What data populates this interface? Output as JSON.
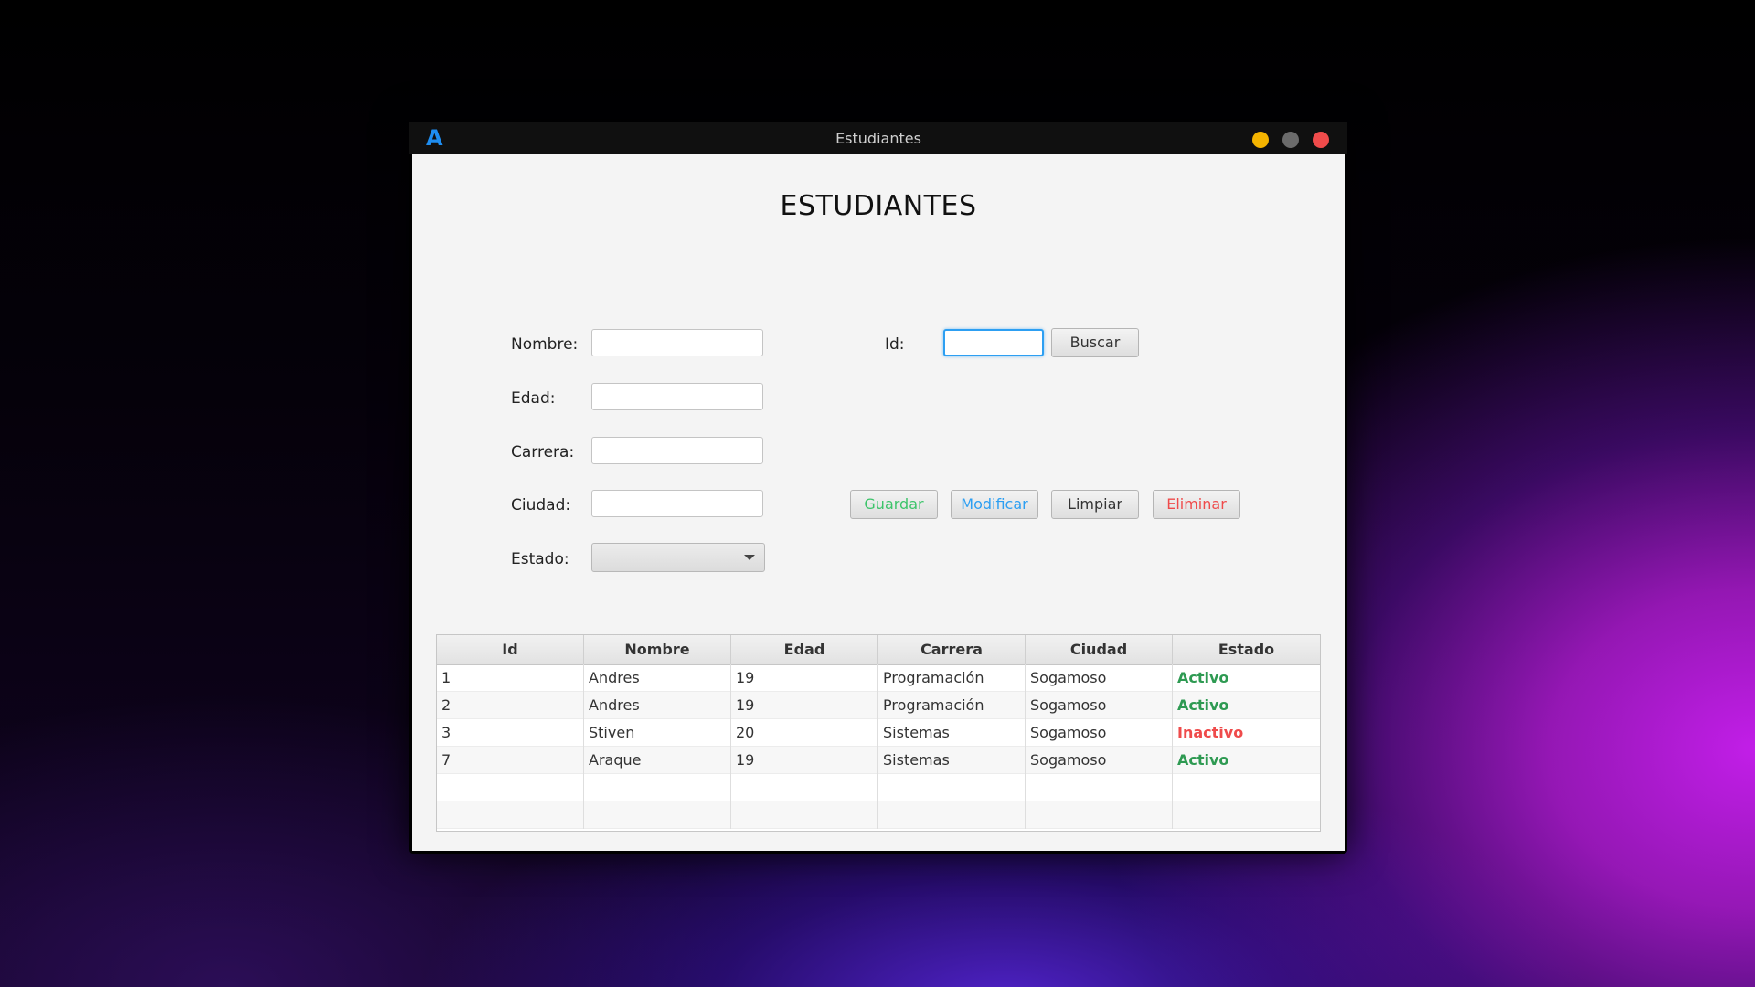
{
  "window": {
    "title": "Estudiantes",
    "logo_text": "A",
    "logo_color": "#1e8df0"
  },
  "form": {
    "heading": "ESTUDIANTES",
    "labels": {
      "nombre": "Nombre:",
      "edad": "Edad:",
      "carrera": "Carrera:",
      "ciudad": "Ciudad:",
      "estado": "Estado:",
      "id": "Id:"
    },
    "values": {
      "nombre": "",
      "edad": "",
      "carrera": "",
      "ciudad": "",
      "estado": "",
      "id": ""
    }
  },
  "buttons": {
    "buscar": "Buscar",
    "guardar": "Guardar",
    "modificar": "Modificar",
    "limpiar": "Limpiar",
    "eliminar": "Eliminar"
  },
  "button_colors": {
    "guardar": "#3cc46a",
    "modificar": "#2d9ff2",
    "limpiar": "#333333",
    "eliminar": "#ef4b4b"
  },
  "table": {
    "columns": [
      "Id",
      "Nombre",
      "Edad",
      "Carrera",
      "Ciudad",
      "Estado"
    ],
    "rows": [
      {
        "id": "1",
        "nombre": "Andres",
        "edad": "19",
        "carrera": "Programación",
        "ciudad": "Sogamoso",
        "estado": "Activo"
      },
      {
        "id": "2",
        "nombre": "Andres",
        "edad": "19",
        "carrera": "Programación",
        "ciudad": "Sogamoso",
        "estado": "Activo"
      },
      {
        "id": "3",
        "nombre": "Stiven",
        "edad": "20",
        "carrera": "Sistemas",
        "ciudad": "Sogamoso",
        "estado": "Inactivo"
      },
      {
        "id": "7",
        "nombre": "Araque",
        "edad": "19",
        "carrera": "Sistemas",
        "ciudad": "Sogamoso",
        "estado": "Activo"
      }
    ],
    "status_colors": {
      "Activo": "#2e9a52",
      "Inactivo": "#ef4b4b"
    }
  }
}
